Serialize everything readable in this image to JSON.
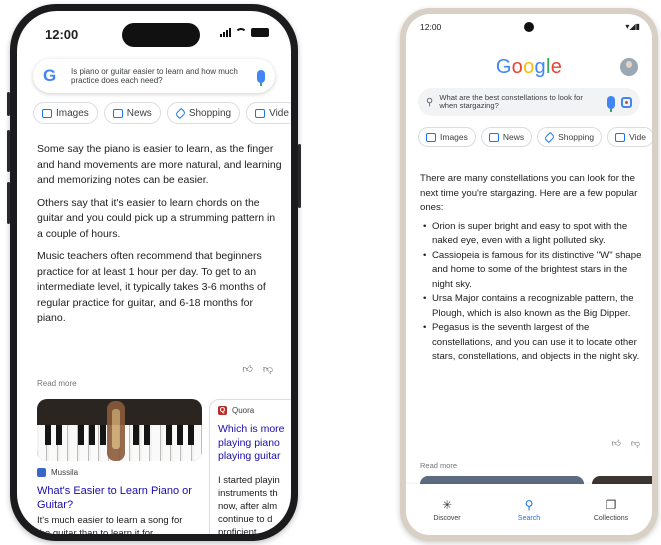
{
  "iphone": {
    "time": "12:00",
    "search_query": "Is piano or guitar easier to learn and how much practice does each need?",
    "chips": [
      "Images",
      "News",
      "Shopping",
      "Vide"
    ],
    "paragraphs": [
      "Some say the piano is easier to learn, as the finger and hand movements are more natural, and learning and memorizing notes can be easier.",
      "Others say that it's easier to learn chords on the guitar and you could pick up a strumming pattern in a couple of hours.",
      "Music teachers often recommend that beginners practice for at least 1 hour per day. To get to an intermediate level, it typically takes 3-6 months of regular practice for guitar, and 6-18 months for piano."
    ],
    "read_more": "Read more",
    "card1": {
      "source": "Mussila",
      "title": "What's Easier to Learn Piano or Guitar?",
      "snippet": "It's much easier to learn a song for the guitar than to learn it for"
    },
    "card2": {
      "source": "Quora",
      "title_lines": [
        "Which is more",
        "playing piano",
        "playing guitar"
      ],
      "snippet_lines": [
        "I started playin",
        "instruments th",
        "now, after alm",
        "continue to d",
        "proficient"
      ]
    }
  },
  "android": {
    "time": "12:00",
    "status_icons": "▾◢▮",
    "logo": [
      {
        "char": "G",
        "color": "#4285F4"
      },
      {
        "char": "o",
        "color": "#EA4335"
      },
      {
        "char": "o",
        "color": "#FBBC05"
      },
      {
        "char": "g",
        "color": "#4285F4"
      },
      {
        "char": "l",
        "color": "#34A853"
      },
      {
        "char": "e",
        "color": "#EA4335"
      }
    ],
    "search_query": "What are the best constellations to look for when stargazing?",
    "chips": [
      "Images",
      "News",
      "Shopping",
      "Vide"
    ],
    "intro": "There are many constellations you can look for the next time you're stargazing. Here are a few popular ones:",
    "bullets": [
      "Orion is super bright and easy to spot with the naked eye, even with a light polluted sky.",
      "Cassiopeia is famous for its distinctive \"W\" shape and home to some of the brightest stars in the night sky.",
      "Ursa Major contains a recognizable pattern, the Plough, which is also known as the Big Dipper.",
      "Pegasus is the seventh largest of the constellations, and you can use it to locate other stars, constellations, and objects in the night sky."
    ],
    "read_more": "Read more",
    "nav": [
      {
        "label": "Discover",
        "icon": "✳"
      },
      {
        "label": "Search",
        "icon": "⚲"
      },
      {
        "label": "Collections",
        "icon": "❐"
      }
    ]
  },
  "colors": {
    "link": "#1a0dab",
    "accent": "#1a73e8"
  }
}
